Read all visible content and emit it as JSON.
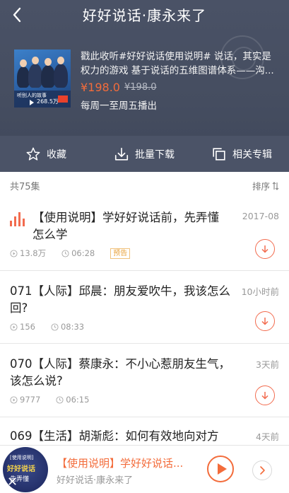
{
  "header": {
    "title": "好好说话·康永来了"
  },
  "album": {
    "cover_text": "听别人的故事",
    "cover_plays": "268.5万",
    "description": "戳此收听#好好说话使用说明# 说话，其实是权力的游戏 基于说话的五维图谱体系——沟...",
    "price": "¥198.0",
    "original_price": "¥198.0",
    "schedule": "每周一至周五播出"
  },
  "actions": {
    "favorite_label": "收藏",
    "batch_download_label": "批量下载",
    "related_label": "相关专辑"
  },
  "list": {
    "total": "共75集",
    "sort_label": "排序"
  },
  "episodes": [
    {
      "title": "【使用说明】学好好说话前，先弄懂怎么学",
      "date": "2017-08",
      "plays": "13.8万",
      "duration": "06:28",
      "badge": "预告"
    },
    {
      "title": "071【人际】邱晨：朋友爱吹牛，我该怎么回?",
      "date": "10小时前",
      "plays": "156",
      "duration": "08:33"
    },
    {
      "title": "070【人际】蔡康永：不小心惹朋友生气，该怎么说?",
      "date": "3天前",
      "plays": "9777",
      "duration": "06:15"
    },
    {
      "title": "069【生活】胡渐彪：如何有效地向对方",
      "date": "4天前"
    }
  ],
  "player": {
    "title": "【使用说明】学好好说话...",
    "subtitle": "好好说话·康永来了",
    "cover_line1": "[使用说明]",
    "cover_line2": "好好说话",
    "cover_line3": "先弄懂"
  },
  "colors": {
    "accent": "#f36c3b",
    "header_bg": "#4a5266"
  }
}
